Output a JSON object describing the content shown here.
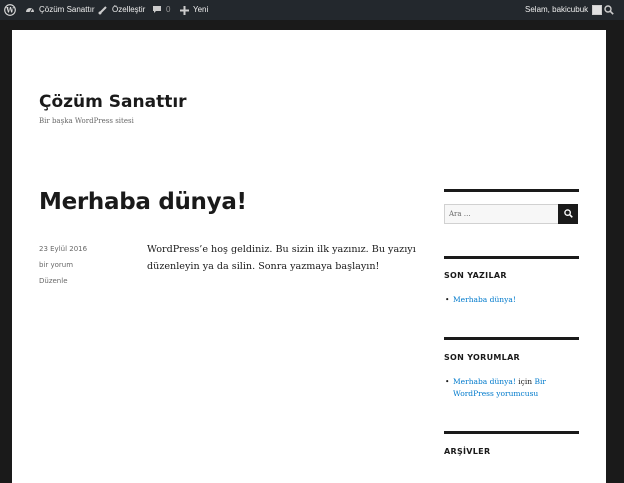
{
  "admin_bar": {
    "site_name": "Çözüm Sanattır",
    "customize": "Özelleştir",
    "comments_count": "0",
    "new": "Yeni",
    "greeting": "Selam, bakicubuk"
  },
  "site": {
    "title": "Çözüm Sanattır",
    "description": "Bir başka WordPress sitesi"
  },
  "post": {
    "title": "Merhaba dünya!",
    "date": "23 Eylül 2016",
    "comments": "bir yorum",
    "edit": "Düzenle",
    "content": "WordPress’e hoş geldiniz. Bu sizin ilk yazınız. Bu yazıyı düzenleyin ya da silin. Sonra yazmaya başlayın!"
  },
  "sidebar": {
    "search_placeholder": "Ara …",
    "recent_posts_title": "SON YAZILAR",
    "recent_posts": [
      "Merhaba dünya!"
    ],
    "recent_comments_title": "SON YORUMLAR",
    "recent_comment": {
      "post": "Merhaba dünya!",
      "connector": " için ",
      "author": "Bir WordPress yorumcusu"
    },
    "archives_title": "ARŞİVLER"
  },
  "colors": {
    "admin_bar": "#23282d",
    "link": "#007acc",
    "frame": "#1a1a1a"
  }
}
